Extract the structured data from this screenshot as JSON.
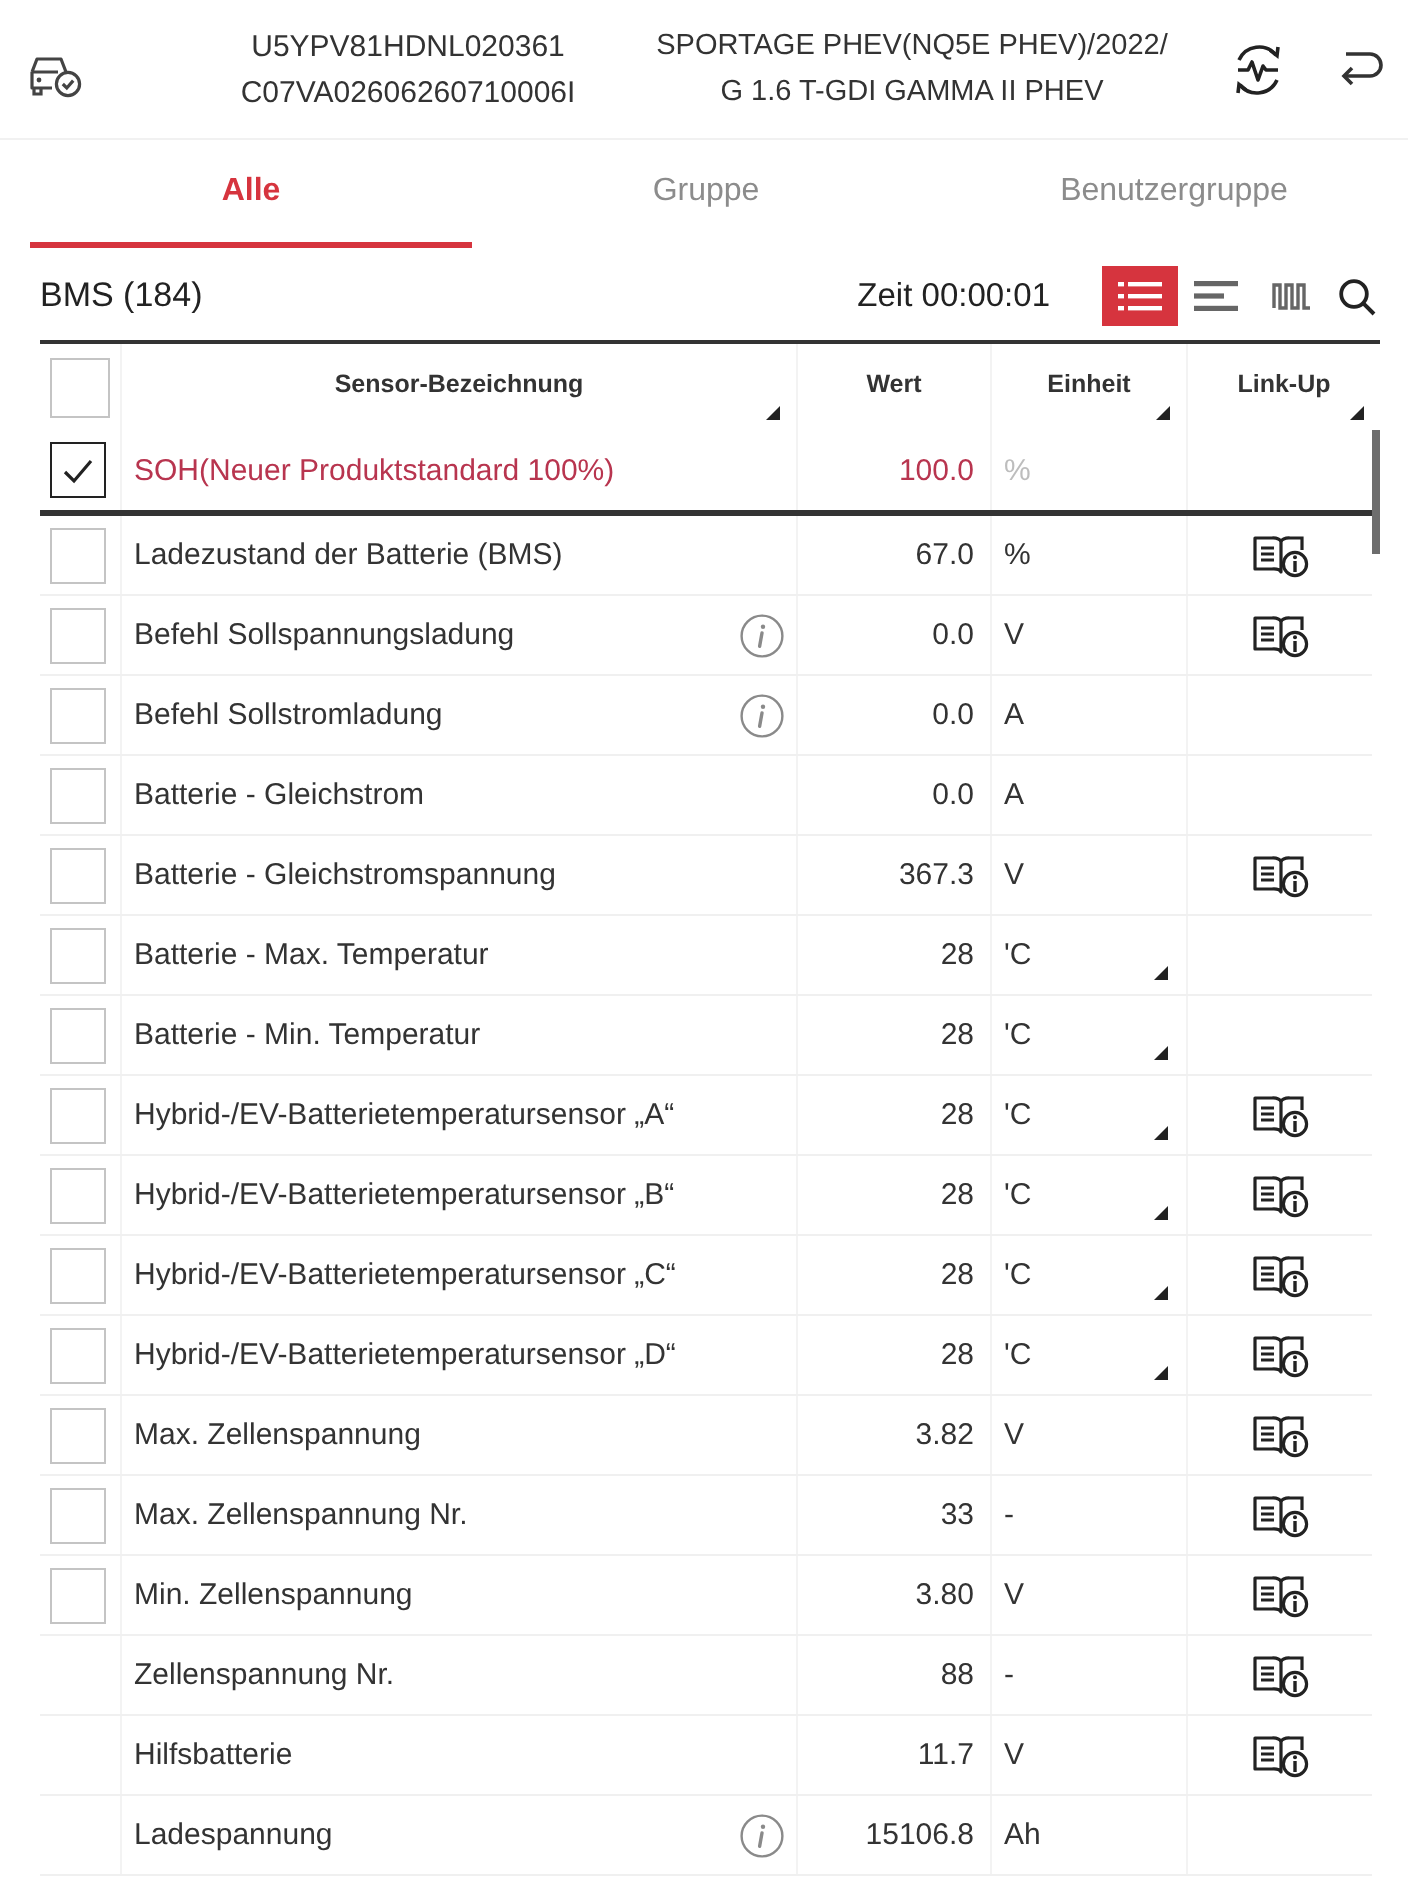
{
  "header": {
    "vin_lines": [
      "U5YPV81HDNL020361",
      "C07VA02606260710006I"
    ],
    "vehicle_lines": [
      "SPORTAGE PHEV(NQ5E PHEV)/2022/",
      "G 1.6 T-GDI GAMMA II PHEV"
    ]
  },
  "tabs": [
    {
      "label": "Alle",
      "selected": true
    },
    {
      "label": "Gruppe",
      "selected": false
    },
    {
      "label": "Benutzergruppe",
      "selected": false
    }
  ],
  "toolbar": {
    "module": "BMS (184)",
    "timer": "Zeit 00:00:01",
    "views": [
      {
        "kind": "list",
        "selected": true
      },
      {
        "kind": "lines",
        "selected": false
      },
      {
        "kind": "wave",
        "selected": false
      }
    ]
  },
  "table": {
    "all_checked": false,
    "columns": [
      {
        "label": "Sensor-Bezeichnung",
        "sortable": true
      },
      {
        "label": "Wert",
        "sortable": false
      },
      {
        "label": "Einheit",
        "sortable": true
      },
      {
        "label": "Link-Up",
        "sortable": true
      }
    ],
    "rows": [
      {
        "name": "SOH(Neuer Produktstandard 100%)",
        "value": "100.0",
        "unit": "%",
        "checked": true,
        "info": false,
        "unit_menu": false,
        "link": false
      },
      {
        "name": "Ladezustand der Batterie (BMS)",
        "value": "67.0",
        "unit": "%",
        "checked": false,
        "info": false,
        "unit_menu": false,
        "link": true
      },
      {
        "name": "Befehl Sollspannungsladung",
        "value": "0.0",
        "unit": "V",
        "checked": false,
        "info": true,
        "unit_menu": false,
        "link": true
      },
      {
        "name": "Befehl Sollstromladung",
        "value": "0.0",
        "unit": "A",
        "checked": false,
        "info": true,
        "unit_menu": false,
        "link": false
      },
      {
        "name": "Batterie - Gleichstrom",
        "value": "0.0",
        "unit": "A",
        "checked": false,
        "info": false,
        "unit_menu": false,
        "link": false
      },
      {
        "name": "Batterie - Gleichstromspannung",
        "value": "367.3",
        "unit": "V",
        "checked": false,
        "info": false,
        "unit_menu": false,
        "link": true
      },
      {
        "name": "Batterie - Max. Temperatur",
        "value": "28",
        "unit": "'C",
        "checked": false,
        "info": false,
        "unit_menu": true,
        "link": false
      },
      {
        "name": "Batterie - Min. Temperatur",
        "value": "28",
        "unit": "'C",
        "checked": false,
        "info": false,
        "unit_menu": true,
        "link": false
      },
      {
        "name": "Hybrid-/EV-Batterietemperatursensor „A“",
        "value": "28",
        "unit": "'C",
        "checked": false,
        "info": false,
        "unit_menu": true,
        "link": true
      },
      {
        "name": "Hybrid-/EV-Batterietemperatursensor „B“",
        "value": "28",
        "unit": "'C",
        "checked": false,
        "info": false,
        "unit_menu": true,
        "link": true
      },
      {
        "name": "Hybrid-/EV-Batterietemperatursensor „C“",
        "value": "28",
        "unit": "'C",
        "checked": false,
        "info": false,
        "unit_menu": true,
        "link": true
      },
      {
        "name": "Hybrid-/EV-Batterietemperatursensor „D“",
        "value": "28",
        "unit": "'C",
        "checked": false,
        "info": false,
        "unit_menu": true,
        "link": true
      },
      {
        "name": "Max. Zellenspannung",
        "value": "3.82",
        "unit": "V",
        "checked": false,
        "info": false,
        "unit_menu": false,
        "link": true
      },
      {
        "name": "Max. Zellenspannung Nr.",
        "value": "33",
        "unit": "-",
        "checked": false,
        "info": false,
        "unit_menu": false,
        "link": true
      },
      {
        "name": "Min. Zellenspannung",
        "value": "3.80",
        "unit": "V",
        "checked": false,
        "info": false,
        "unit_menu": false,
        "link": true
      },
      {
        "name": "Zellenspannung Nr.",
        "value": "88",
        "unit": "-",
        "info": false,
        "unit_menu": false,
        "link": true
      },
      {
        "name": "Hilfsbatterie",
        "value": "11.7",
        "unit": "V",
        "info": false,
        "unit_menu": false,
        "link": true
      },
      {
        "name": "Ladespannung",
        "value": "15106.8",
        "unit": "Ah",
        "info": true,
        "unit_menu": false,
        "link": false
      }
    ]
  }
}
